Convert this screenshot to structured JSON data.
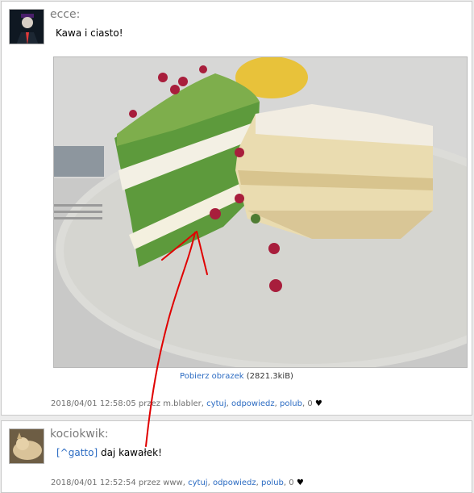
{
  "post1": {
    "username": "ecce:",
    "message": "Kawa i ciasto!",
    "download_link": "Pobierz obrazek",
    "download_size": "(2821.3kiB)",
    "timestamp": "2018/04/01 12:58:05 przez",
    "author": "m.blabler",
    "actions": {
      "quote": "cytuj",
      "reply": "odpowiedz",
      "like": "polub"
    },
    "like_count": "0",
    "heart": "♥",
    "comma": ","
  },
  "post2": {
    "username": "kociokwik:",
    "mention": "[^gatto]",
    "message": " daj kawałek!",
    "timestamp": "2018/04/01 12:52:54 przez",
    "author": "www",
    "actions": {
      "quote": "cytuj",
      "reply": "odpowiedz",
      "like": "polub"
    },
    "like_count": "0",
    "heart": "♥",
    "comma": ","
  },
  "colors": {
    "link": "#2b6bc2",
    "annotation": "#e00000"
  }
}
